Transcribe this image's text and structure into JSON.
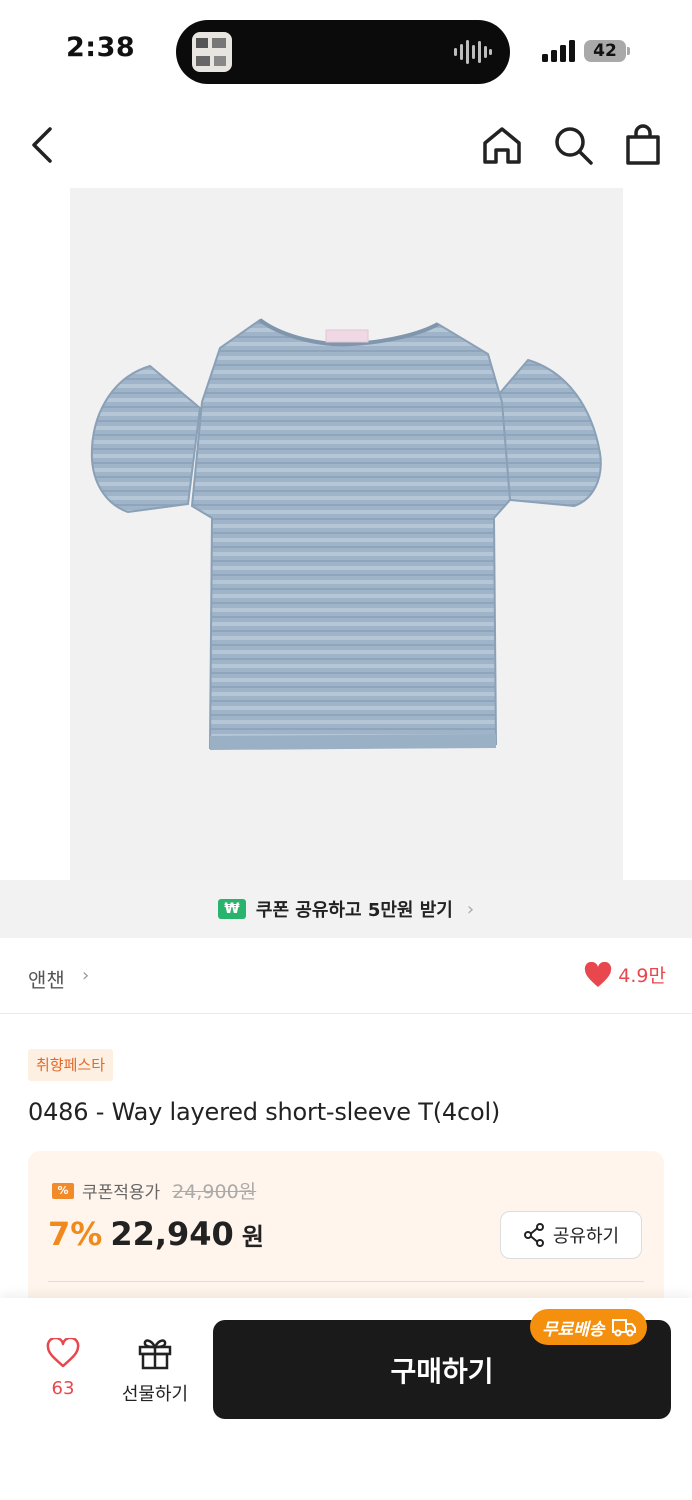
{
  "status_bar": {
    "time": "2:38",
    "battery": "42"
  },
  "nav": {
    "back_icon": "chevron-left-icon",
    "home_icon": "home-icon",
    "search_icon": "search-icon",
    "cart_icon": "shopping-bag-icon"
  },
  "coupon_banner": {
    "badge": "₩",
    "text": "쿠폰 공유하고 5만원 받기",
    "chevron": "›"
  },
  "brand": {
    "name": "앤챈",
    "chevron": "›",
    "likes": "4.9만"
  },
  "product": {
    "badge": "취향페스타",
    "title": "0486 - Way layered short-sleeve T(4col)"
  },
  "price": {
    "coupon_icon": "%",
    "coupon_label": "쿠폰적용가",
    "original": "24,900원",
    "discount": "7%",
    "amount": "22,940",
    "currency": "원",
    "share_label": "공유하기"
  },
  "bottom_bar": {
    "like_count": "63",
    "gift_label": "선물하기",
    "buy_label": "구매하기",
    "free_shipping": "무료배송"
  },
  "colors": {
    "accent_orange": "#f08a1c",
    "heart_red": "#e8474d",
    "green_badge": "#29b46e",
    "buy_button": "#1a1a1a"
  }
}
